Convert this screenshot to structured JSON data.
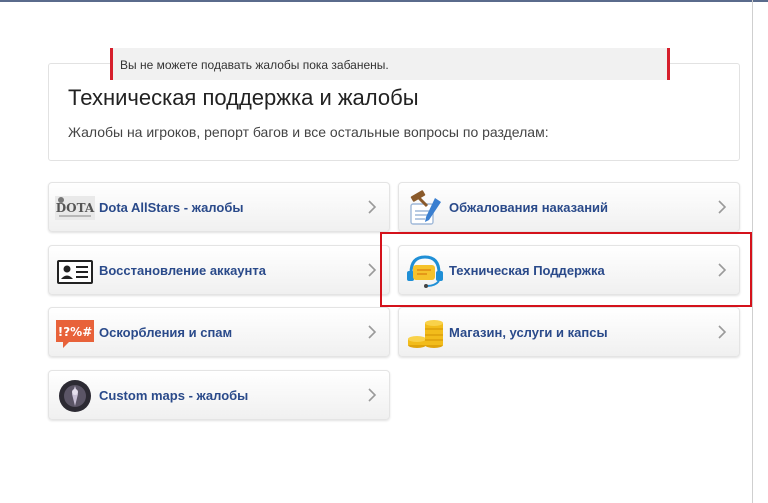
{
  "alert": {
    "text": "Вы не можете подавать жалобы пока забанены."
  },
  "header": {
    "title": "Техническая поддержка и жалобы",
    "subtitle": "Жалобы на игроков, репорт багов и все остальные вопросы по разделам:"
  },
  "categories": [
    {
      "label": "Dota AllStars - жалобы",
      "icon": "dota-logo-icon"
    },
    {
      "label": "Обжалования наказаний",
      "icon": "gavel-document-icon"
    },
    {
      "label": "Восстановление аккаунта",
      "icon": "id-card-icon"
    },
    {
      "label": "Техническая Поддержка",
      "icon": "headset-chat-icon"
    },
    {
      "label": "Оскорбления и спам",
      "icon": "swear-symbols-icon",
      "icon_text": "!?%#"
    },
    {
      "label": "Магазин, услуги и капсы",
      "icon": "coin-stacks-icon"
    },
    {
      "label": "Custom maps - жалобы",
      "icon": "custom-map-icon"
    }
  ],
  "colors": {
    "accent_text": "#2a4a8a",
    "alert_bar": "#d61f2c",
    "highlight": "#d4121b"
  }
}
